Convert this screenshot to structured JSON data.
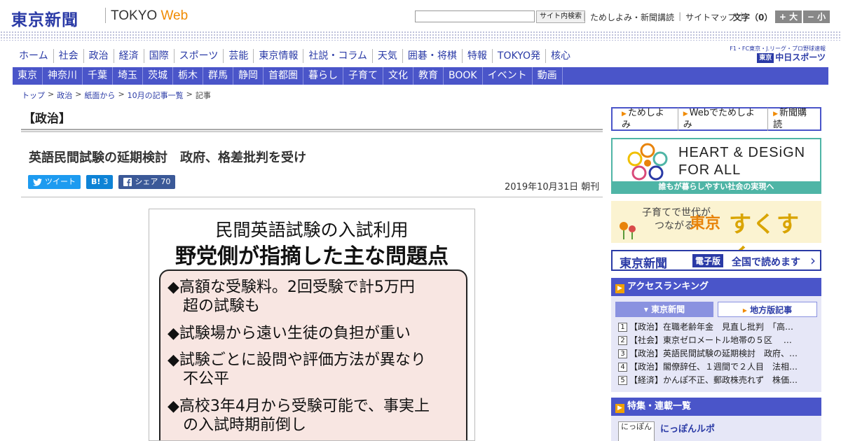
{
  "site": {
    "logo_jp": "東京新聞",
    "logo_tokyo": "TOKYO",
    "logo_web": "Web"
  },
  "header": {
    "search_button": "サイト内検索",
    "links": [
      "ためしよみ・新聞講読",
      "サイトマップ"
    ],
    "fontsize_label": "文字（0）",
    "font_larger": "+ 大",
    "font_smaller": "− 小"
  },
  "nav_main": [
    "ホーム",
    "社会",
    "政治",
    "経済",
    "国際",
    "スポーツ",
    "芸能",
    "東京情報",
    "社説・コラム",
    "天気",
    "囲碁・将棋",
    "特報",
    "TOKYO発",
    "核心"
  ],
  "chunichi_sports": {
    "top": "F1・FC東京・J.リーグ・プロ野球速報",
    "name": "中日スポーツ",
    "prefix": "東京"
  },
  "nav_region": [
    "東京",
    "神奈川",
    "千葉",
    "埼玉",
    "茨城",
    "栃木",
    "群馬",
    "静岡",
    "首都圏",
    "暮らし",
    "子育て",
    "文化",
    "教育",
    "BOOK",
    "イベント",
    "動画"
  ],
  "breadcrumb": {
    "items": [
      "トップ",
      "政治",
      "紙面から",
      "10月の記事一覧"
    ],
    "current": "記事",
    "separator": ">"
  },
  "article": {
    "section": "【政治】",
    "headline": "英語民間試験の延期検討　政府、格差批判を受け",
    "date": "2019年10月31日 朝刊",
    "share": {
      "tweet_label": "ツイート",
      "hatena_label": "B!",
      "hatena_count": "3",
      "facebook_label": "シェア",
      "facebook_count": "70"
    }
  },
  "figure": {
    "title1": "民間英語試験の入試利用",
    "title2": "野党側が指摘した主な問題点",
    "items": [
      "◆高額な受験料。2回受験で計5万円\n　超の試験も",
      "◆試験場から遠い生徒の負担が重い",
      "◆試験ごとに設問や評価方法が異なり\n　不公平",
      "◆高校3年4月から受験可能で、事実上\n　の入試時期前倒し"
    ]
  },
  "sidebar": {
    "subscribe_links": [
      "ためしよみ",
      "Webでためしよみ",
      "新聞購読"
    ],
    "heart_design": {
      "line1": "HEART & DESiGN",
      "line2": "FOR ALL",
      "bar": "誰もが暮らしやすい社会の実現へ"
    },
    "sukusuku": {
      "small1": "子育てで世代が",
      "small2": "つながる",
      "tokyo": "東京",
      "main": "すくすく"
    },
    "digital": {
      "logo": "東京新聞",
      "tag": "電子版",
      "text": "全国で読めます"
    },
    "ranking": {
      "title": "アクセスランキング",
      "tabs": [
        "東京新聞",
        "地方版記事"
      ],
      "items": [
        "【政治】在職老齢年金　見直し批判　「高…",
        "【社会】東京ゼロメートル地帯の５区　 …",
        "【政治】英語民間試験の延期検討　政府、…",
        "【政治】閣僚辞任、１週間で２人目　法相…",
        "【経済】かんぽ不正、郵政株売れず　株価…"
      ]
    },
    "features": {
      "title": "特集・連載一覧",
      "item_title": "にっぽんルポ",
      "thumb": "にっぽん"
    }
  },
  "colors": {
    "brand_blue": "#2a3aa6",
    "nav_blue": "#4a55c9",
    "accent_orange": "#f08a00",
    "teal": "#4fb5a6"
  }
}
